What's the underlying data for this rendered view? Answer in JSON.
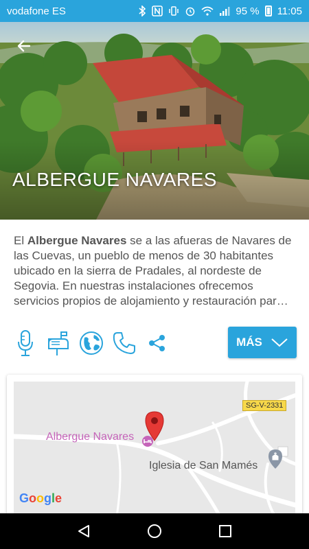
{
  "status_bar": {
    "carrier": "vodafone ES",
    "battery": "95 %",
    "time": "11:05"
  },
  "hero": {
    "title": "ALBERGUE NAVARES"
  },
  "description": {
    "lead": "El ",
    "name": "Albergue Navares",
    "body": " se a las afueras de Navares de las Cuevas, un pueblo de menos de 30 habitantes ubicado en la sierra de Pradales, al nordeste de Segovia. En nuestras instalaciones ofrecemos servicios propios de alojamiento y restauración par…"
  },
  "actions": {
    "icons": [
      "microphone-icon",
      "mailbox-icon",
      "globe-icon",
      "phone-icon",
      "share-icon"
    ],
    "more_label": "MÁS"
  },
  "map": {
    "road_label": "SG-V-2331",
    "place_name": "Albergue Navares",
    "church_label": "Iglesia de San Mamés",
    "logo_text": "Google"
  },
  "colors": {
    "accent": "#2aa4dc",
    "pin": "#e53935",
    "place": "#c564b9"
  }
}
